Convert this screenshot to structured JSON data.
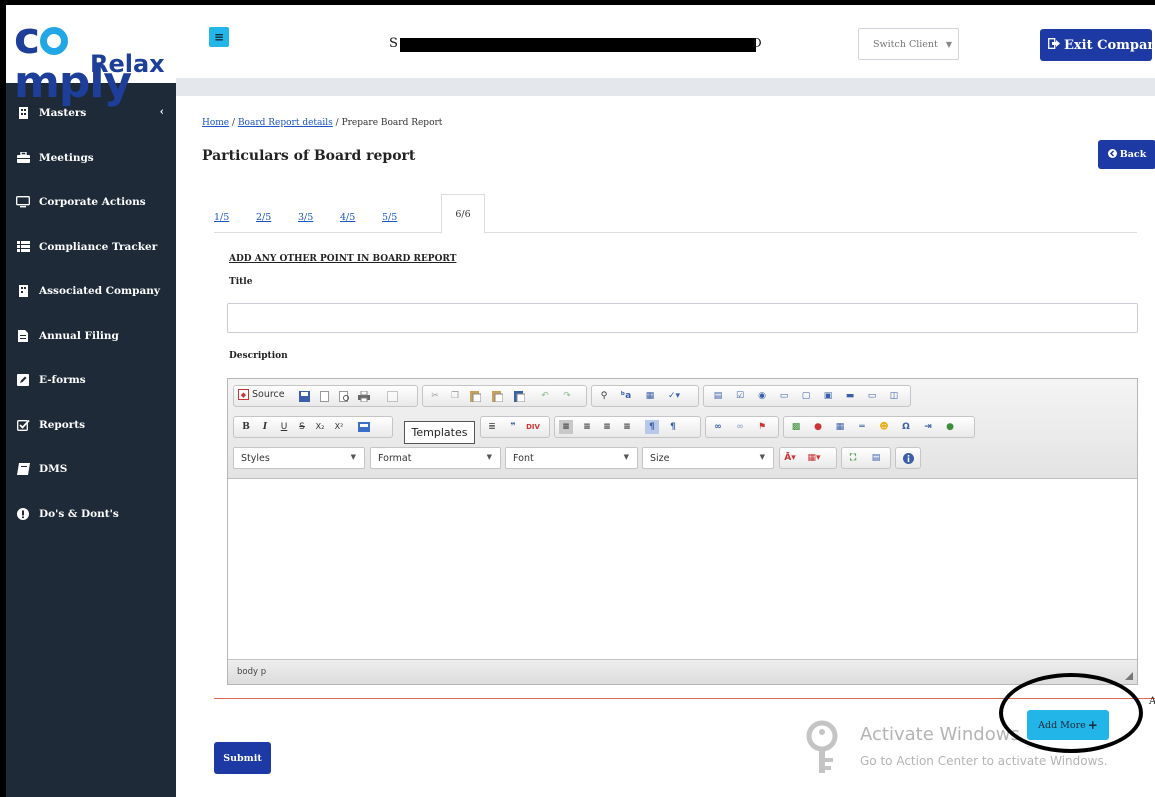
{
  "logo": {
    "part1_a": "c",
    "part1_b": "mply",
    "part2": "Relax"
  },
  "sidebar": {
    "items": [
      {
        "label": "Masters",
        "icon": "building-icon",
        "has_chevron": true,
        "chevron": "‹"
      },
      {
        "label": "Meetings",
        "icon": "briefcase-icon"
      },
      {
        "label": "Corporate Actions",
        "icon": "monitor-icon"
      },
      {
        "label": "Compliance Tracker",
        "icon": "list-icon"
      },
      {
        "label": "Associated Company",
        "icon": "building-icon"
      },
      {
        "label": "Annual Filing",
        "icon": "file-icon"
      },
      {
        "label": "E-forms",
        "icon": "edit-icon"
      },
      {
        "label": "Reports",
        "icon": "checkbox-icon"
      },
      {
        "label": "DMS",
        "icon": "book-icon"
      },
      {
        "label": "Do's & Dont's",
        "icon": "exclamation-icon"
      }
    ]
  },
  "topbar": {
    "menu_icon": "≡",
    "company_name_start": "S",
    "company_name_end": "D",
    "switch_client": "Switch Client",
    "exit_company": "Exit Company"
  },
  "breadcrumb": {
    "home": "Home",
    "sep1": "/",
    "board_report_details": "Board Report details",
    "sep2": "/",
    "current": "Prepare Board Report"
  },
  "page": {
    "title": "Particulars of Board report",
    "back_label": "Back"
  },
  "tabs": [
    {
      "label": "1/5"
    },
    {
      "label": "2/5"
    },
    {
      "label": "3/5"
    },
    {
      "label": "4/5"
    },
    {
      "label": "5/5"
    },
    {
      "label": "6/6",
      "active": true
    }
  ],
  "form": {
    "section_heading": "ADD ANY OTHER POINT IN BOARD REPORT",
    "title_label": "Title",
    "title_value": "",
    "description_label": "Description"
  },
  "editor": {
    "source_label": "Source",
    "row2_text_buttons": [
      "B",
      "I",
      "U",
      "S",
      "X₂",
      "X²"
    ],
    "tooltip": "Templates",
    "styles": "Styles",
    "format": "Format",
    "font": "Font",
    "size": "Size",
    "status_path": "body  p"
  },
  "actions": {
    "submit": "Submit",
    "add_more": "Add More"
  },
  "watermark": {
    "line1": "Activate Windows",
    "line2": "Go to Action Center to activate Windows."
  },
  "colors": {
    "sidebar_bg": "#1e2a38",
    "primary": "#1c39a4",
    "accent": "#22b5e8",
    "link": "#1a55c7",
    "divider_red": "#e06a5a"
  },
  "edge_mark": "A"
}
